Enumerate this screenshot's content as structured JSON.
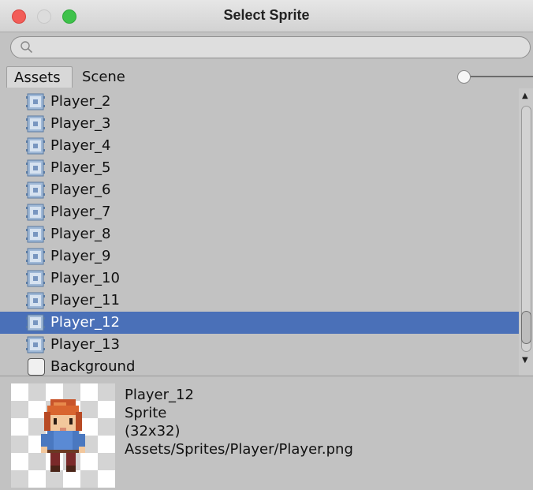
{
  "window": {
    "title": "Select Sprite"
  },
  "search": {
    "value": "",
    "placeholder": ""
  },
  "tabs": [
    {
      "label": "Assets",
      "selected": true
    },
    {
      "label": "Scene",
      "selected": false
    }
  ],
  "list": {
    "items": [
      {
        "label": "Player_2",
        "icon": "sprite-icon",
        "selected": false
      },
      {
        "label": "Player_3",
        "icon": "sprite-icon",
        "selected": false
      },
      {
        "label": "Player_4",
        "icon": "sprite-icon",
        "selected": false
      },
      {
        "label": "Player_5",
        "icon": "sprite-icon",
        "selected": false
      },
      {
        "label": "Player_6",
        "icon": "sprite-icon",
        "selected": false
      },
      {
        "label": "Player_7",
        "icon": "sprite-icon",
        "selected": false
      },
      {
        "label": "Player_8",
        "icon": "sprite-icon",
        "selected": false
      },
      {
        "label": "Player_9",
        "icon": "sprite-icon",
        "selected": false
      },
      {
        "label": "Player_10",
        "icon": "sprite-icon",
        "selected": false
      },
      {
        "label": "Player_11",
        "icon": "sprite-icon",
        "selected": false
      },
      {
        "label": "Player_12",
        "icon": "sprite-icon",
        "selected": true
      },
      {
        "label": "Player_13",
        "icon": "sprite-icon",
        "selected": false
      },
      {
        "label": "Background",
        "icon": "none-checkbox-icon",
        "selected": false
      }
    ]
  },
  "preview": {
    "name": "Player_12",
    "type": "Sprite",
    "size": "(32x32)",
    "path": "Assets/Sprites/Player/Player.png"
  },
  "colors": {
    "selection": "#4a70b8",
    "window_bg": "#c2c2c2",
    "close_light": "#f25d58",
    "zoom_light": "#3ec24a"
  }
}
